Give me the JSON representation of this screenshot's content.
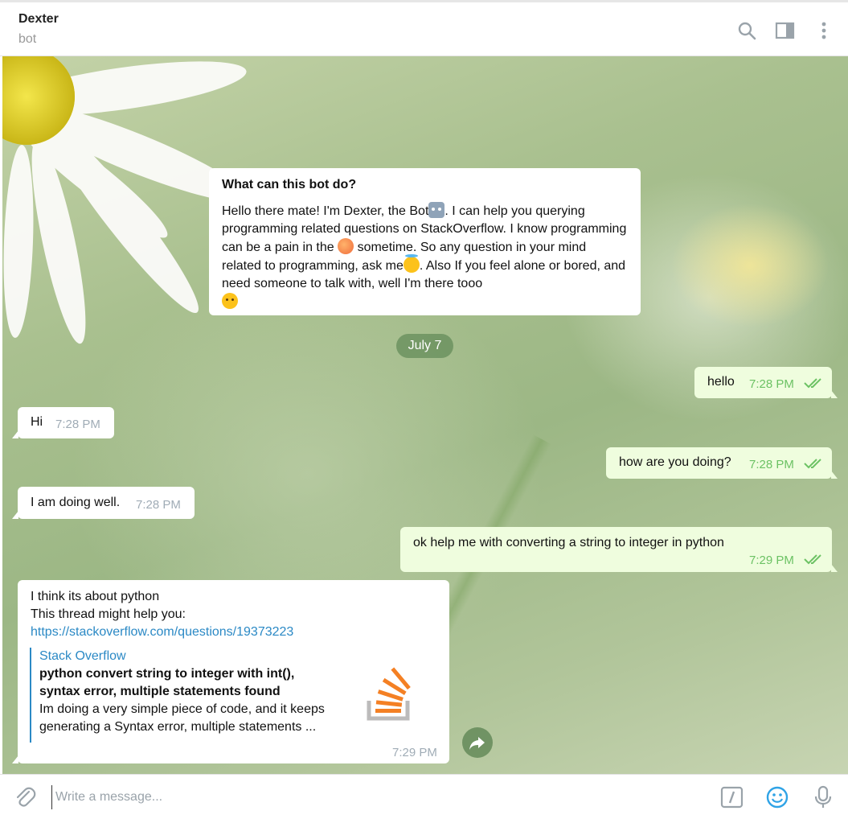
{
  "header": {
    "chat_name": "Dexter",
    "chat_status": "bot",
    "icons": [
      "search-icon",
      "sidebar-toggle-icon",
      "more-vertical-icon"
    ]
  },
  "intro": {
    "title": "What can this bot do?",
    "part1": "Hello there mate! I'm Dexter, the Bot",
    "part2": ". I can help you querying programming related questions on StackOverflow. I know programming can be a pain in the",
    "part3": " sometime. So any question in your mind related to programming, ask me",
    "part4": ". Also If you feel alone or bored, and need someone to talk with, well I'm there tooo"
  },
  "date_separator": "July 7",
  "messages": [
    {
      "text": "hello",
      "time": "7:28 PM"
    },
    {
      "text": "Hi",
      "time": "7:28 PM"
    },
    {
      "text": "how are you doing?",
      "time": "7:28 PM"
    },
    {
      "text": "I am doing well.",
      "time": "7:28 PM"
    },
    {
      "text": "ok help me with converting a string to integer in python",
      "time": "7:29 PM"
    },
    {
      "line1": "I think its about python",
      "line2": "This thread might help you:",
      "link": "https://stackoverflow.com/questions/19373223",
      "time": "7:29 PM",
      "preview": {
        "site": "Stack Overflow",
        "title_line1": "python convert string to integer with int(),",
        "title_line2": "syntax error, multiple statements found",
        "desc_line1": "Im doing a very simple piece of code, and it keeps",
        "desc_line2": "generating a Syntax error, multiple statements ..."
      }
    }
  ],
  "composer": {
    "placeholder": "Write a message...",
    "icons": [
      "attach-icon",
      "bot-command-icon",
      "emoji-icon",
      "microphone-icon"
    ]
  },
  "colors": {
    "outgoing_bubble": "#effdde",
    "incoming_bubble": "#ffffff",
    "link": "#2b89c5",
    "read_check": "#6cc264"
  }
}
